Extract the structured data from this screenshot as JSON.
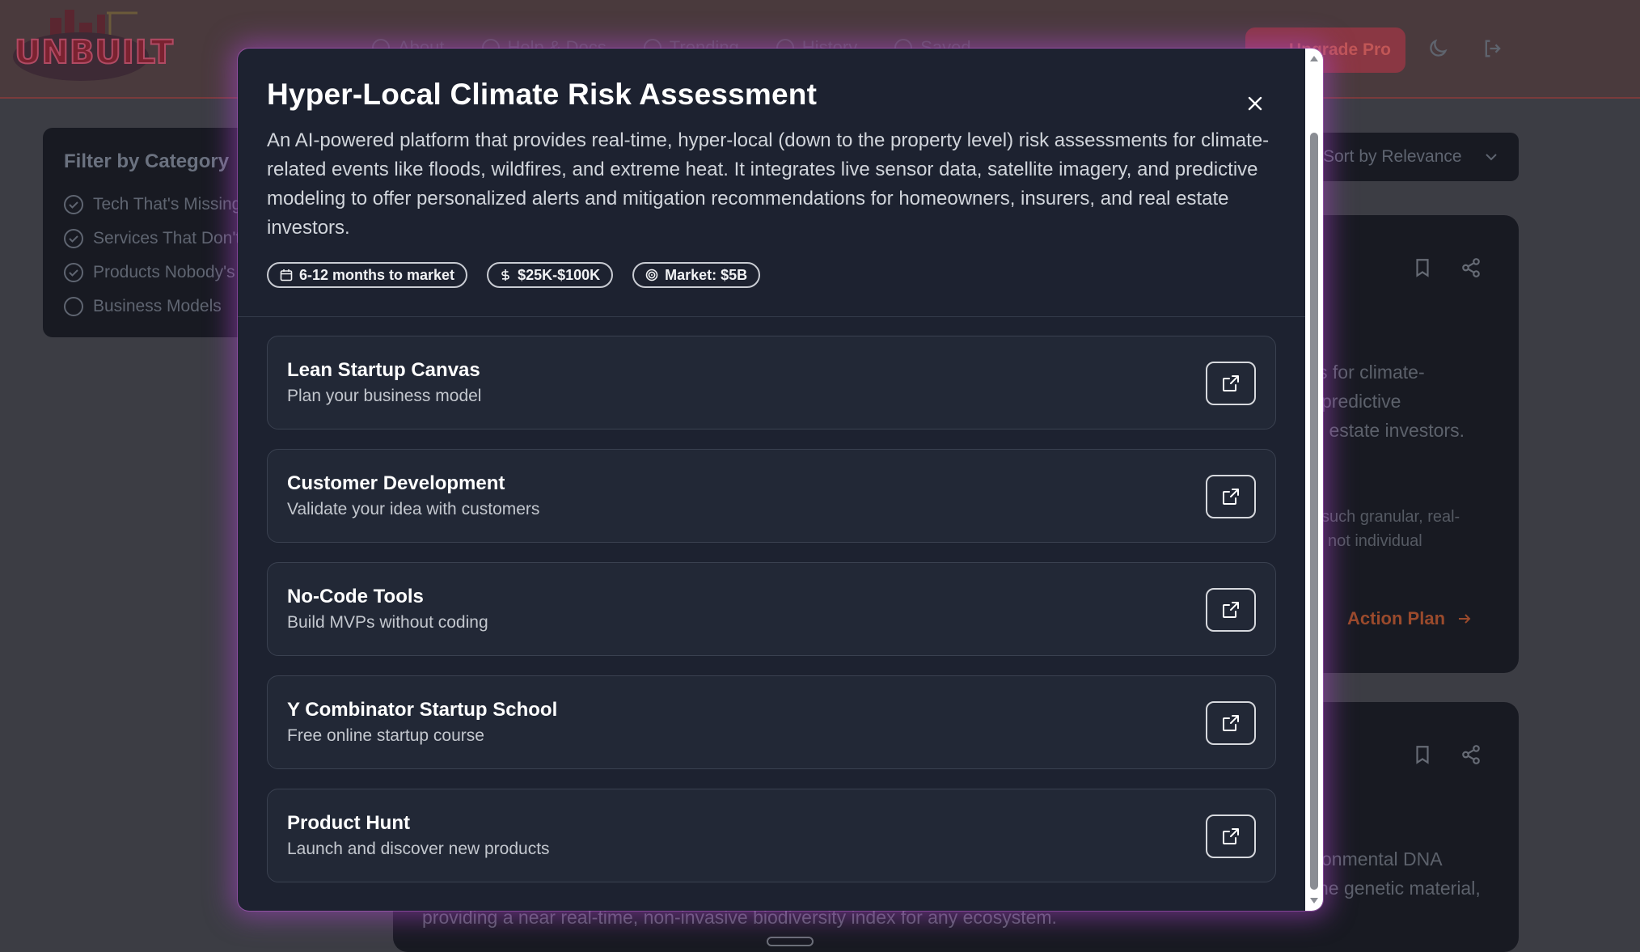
{
  "app": {
    "logo_text": "UNBUILT",
    "nav": [
      "About",
      "Help & Docs",
      "Trending",
      "History",
      "Saved"
    ],
    "upgrade_label": "Upgrade Pro"
  },
  "sidebar": {
    "title": "Filter by Category",
    "items": [
      {
        "label": "Tech That's Missing",
        "checked": true
      },
      {
        "label": "Services That Don't",
        "checked": true
      },
      {
        "label": "Products Nobody's",
        "checked": true
      },
      {
        "label": "Business Models",
        "checked": false
      }
    ]
  },
  "sort": {
    "label": "Sort by Relevance"
  },
  "background_cards": {
    "card1": {
      "lines": [
        "s for climate-",
        "predictive",
        "l estate investors."
      ],
      "sub_lines": [
        "such granular, real-",
        "not individual"
      ],
      "action_label": "Action Plan"
    },
    "card2": {
      "lines": [
        "onmental DNA",
        "ne genetic material,"
      ],
      "bottom_line": "providing a near real-time, non-invasive biodiversity index for any ecosystem."
    }
  },
  "modal": {
    "title": "Hyper-Local Climate Risk Assessment",
    "description": "An AI-powered platform that provides real-time, hyper-local (down to the property level) risk assessments for climate-related events like floods, wildfires, and extreme heat. It integrates live sensor data, satellite imagery, and predictive modeling to offer personalized alerts and mitigation recommendations for homeowners, insurers, and real estate investors.",
    "tags": [
      {
        "icon": "calendar-icon",
        "label": "6-12 months to market"
      },
      {
        "icon": "dollar-icon",
        "label": "$25K-$100K"
      },
      {
        "icon": "target-icon",
        "label": "Market: $5B"
      }
    ],
    "resources": [
      {
        "title": "Lean Startup Canvas",
        "subtitle": "Plan your business model"
      },
      {
        "title": "Customer Development",
        "subtitle": "Validate your idea with customers"
      },
      {
        "title": "No-Code Tools",
        "subtitle": "Build MVPs without coding"
      },
      {
        "title": "Y Combinator Startup School",
        "subtitle": "Free online startup course"
      },
      {
        "title": "Product Hunt",
        "subtitle": "Launch and discover new products"
      }
    ]
  },
  "colors": {
    "modal_bg": "#1d2230",
    "glow": "#aa46c8",
    "accent_orange": "#e36a2c"
  }
}
